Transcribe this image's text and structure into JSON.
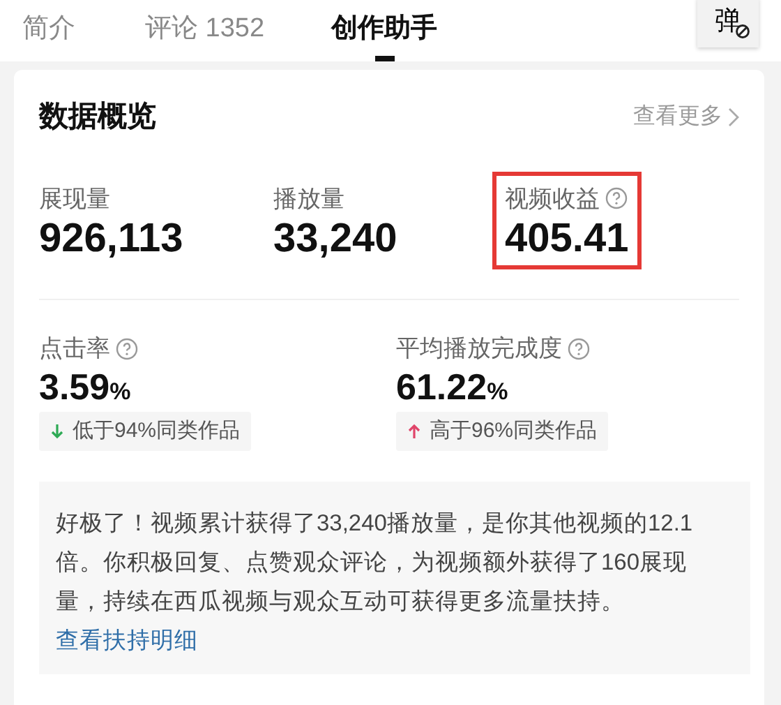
{
  "tabs": [
    {
      "label": "简介",
      "selected": false
    },
    {
      "label": "评论 1352",
      "selected": false
    },
    {
      "label": "创作助手",
      "selected": true
    }
  ],
  "danmaku_button": {
    "label": "弹",
    "off": true
  },
  "overview": {
    "title": "数据概览",
    "more_link": "查看更多",
    "metrics": [
      {
        "label": "展现量",
        "value": "926,113",
        "help": false,
        "highlighted": false
      },
      {
        "label": "播放量",
        "value": "33,240",
        "help": false,
        "highlighted": false
      },
      {
        "label": "视频收益",
        "value": "405.41",
        "help": true,
        "highlighted": true
      }
    ],
    "rates": [
      {
        "label": "点击率",
        "value": "3.59",
        "unit": "%",
        "help": true,
        "trend_up": false,
        "comparison": "低于94%同类作品"
      },
      {
        "label": "平均播放完成度",
        "value": "61.22",
        "unit": "%",
        "help": true,
        "trend_up": true,
        "comparison": "高于96%同类作品"
      }
    ],
    "summary": {
      "text": "好极了！视频累计获得了33,240播放量，是你其他视频的12.1倍。你积极回复、点赞观众评论，为视频额外获得了160展现量，持续在西瓜视频与观众互动可获得更多流量扶持。",
      "link": "查看扶持明细"
    }
  }
}
